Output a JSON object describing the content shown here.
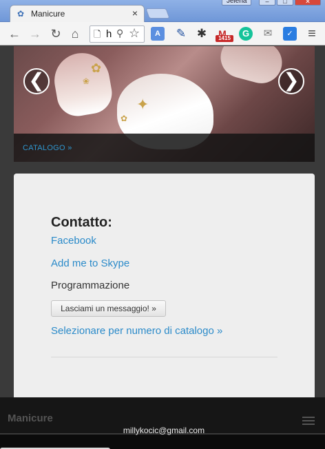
{
  "window": {
    "tab_title": "Manicure",
    "tab_close": "×",
    "profile_name": "Jelena",
    "minimize": "–",
    "maximize": "□",
    "close": "✕"
  },
  "toolbar": {
    "back": "←",
    "forward": "→",
    "reload": "↻",
    "home": "⌂",
    "address_text": "h",
    "page_glyph": "🗋",
    "zoom_glyph": "⚲",
    "star_glyph": "☆",
    "menu": "≡",
    "extensions": [
      {
        "name": "translate-extension-icon",
        "text": "A",
        "color": "#5b8fe0"
      },
      {
        "name": "pen-extension-icon",
        "text": "✎",
        "color": "#1f4f9e"
      },
      {
        "name": "gear-extension-icon",
        "text": "✱",
        "color": "#333333"
      },
      {
        "name": "gmail-extension-icon",
        "text": "M",
        "color": "#c62828",
        "badge": "1415"
      },
      {
        "name": "grammarly-extension-icon",
        "text": "G",
        "color": "#15c39a"
      },
      {
        "name": "note-extension-icon",
        "text": "✉",
        "color": "#777777"
      },
      {
        "name": "check-extension-icon",
        "text": "✓",
        "color": "#2a7de1"
      }
    ]
  },
  "carousel": {
    "caption_link": "CATALOGO »",
    "prev": "❮",
    "next": "❯"
  },
  "contact": {
    "title": "Contatto:",
    "facebook": "Facebook",
    "skype": "Add me to Skype",
    "schedule": "Programmazione",
    "message_button": "Lasciami un messaggio! »",
    "catalog_link": "Selezionare per numero di catalogo »"
  },
  "footer": {
    "brand": "Manicure",
    "email": "millykocic@gmail.com"
  }
}
